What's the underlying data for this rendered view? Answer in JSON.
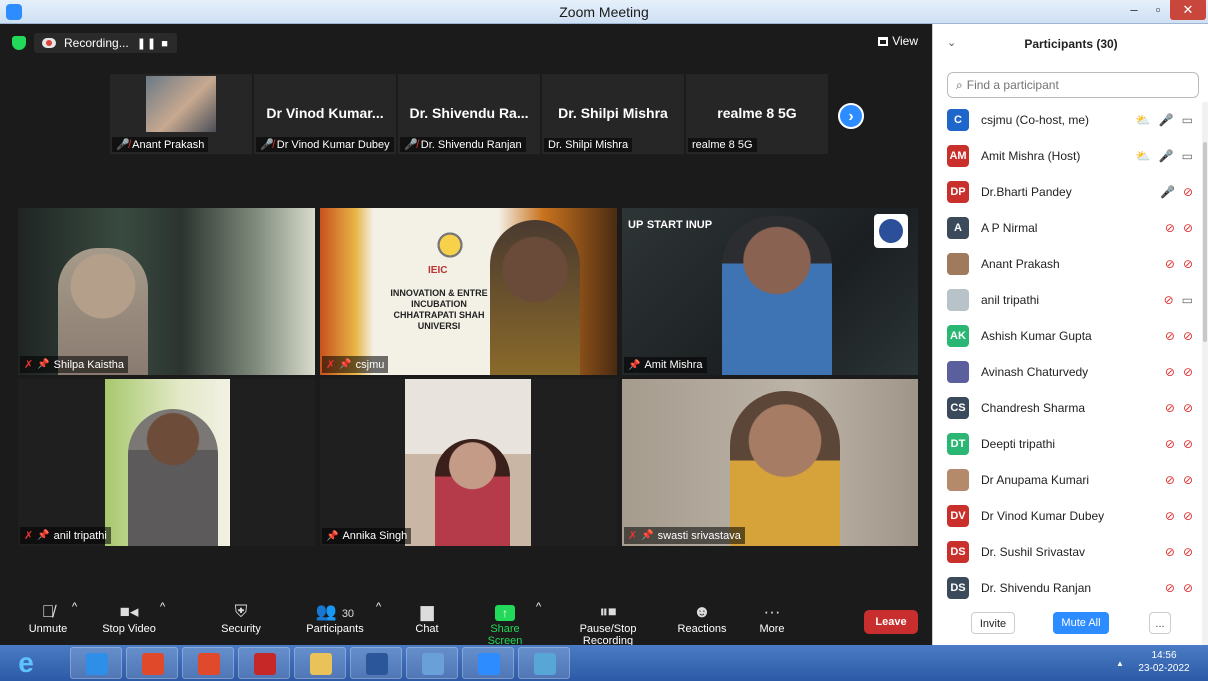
{
  "window": {
    "title": "Zoom Meeting",
    "min": "–",
    "max": "▫",
    "close": "✕"
  },
  "meeting": {
    "recording_label": "Recording...",
    "recording_controls": "❚❚ ■",
    "view_label": "View",
    "filmstrip": [
      {
        "big": "",
        "small": "Anant Prakash",
        "has_video": true
      },
      {
        "big": "Dr Vinod Kumar...",
        "small": "Dr Vinod Kumar Dubey",
        "muted": true
      },
      {
        "big": "Dr. Shivendu Ra...",
        "small": "Dr. Shivendu Ranjan",
        "muted": true
      },
      {
        "big": "Dr. Shilpi Mishra",
        "small": "Dr. Shilpi Mishra",
        "muted": false
      },
      {
        "big": "realme 8 5G",
        "small": "realme 8 5G",
        "muted": false
      }
    ],
    "next_arrow": "›",
    "tiles": [
      {
        "name": "Shilpa Kaistha",
        "muted": true
      },
      {
        "name": "csjmu",
        "muted": true
      },
      {
        "name": "Amit Mishra",
        "muted": false
      },
      {
        "name": "anil tripathi",
        "muted": true
      },
      {
        "name": "Annika Singh",
        "muted": false
      },
      {
        "name": "swasti srivastava",
        "muted": true
      }
    ],
    "slide": {
      "logo_text": "IEIC",
      "banner": "INNOVATION & ENTRE\nINCUBATION\nCHHATRAPATI SHAH\nUNIVERSI"
    },
    "startup_logo": {
      "up": "UP",
      "text": "START INUP"
    }
  },
  "toolbar": {
    "unmute": "Unmute",
    "stop_video": "Stop Video",
    "security": "Security",
    "participants": "Participants",
    "participants_count": "30",
    "chat": "Chat",
    "share_screen": "Share Screen",
    "pause_stop_recording": "Pause/Stop Recording",
    "reactions": "Reactions",
    "more": "More",
    "leave": "Leave"
  },
  "panel": {
    "title": "Participants (30)",
    "search_placeholder": "Find a participant",
    "participants": [
      {
        "initials": "C",
        "name": "csjmu (Co-host, me)",
        "color": "#1e66c9",
        "i1": "⛅",
        "i2": "🎤",
        "i3": "▭"
      },
      {
        "initials": "AM",
        "name": "Amit Mishra (Host)",
        "color": "#c9302c",
        "i1": "⛅",
        "i2": "🎤",
        "i3": "▭"
      },
      {
        "initials": "DP",
        "name": "Dr.Bharti Pandey",
        "color": "#c9302c",
        "i2": "🎤",
        "i3": "⊘"
      },
      {
        "initials": "A",
        "name": "A P Nirmal",
        "color": "#3b4a5a",
        "i2": "⊘",
        "i3": "⊘"
      },
      {
        "initials": "",
        "name": "Anant Prakash",
        "color": "#a07a5c",
        "i2": "⊘",
        "i3": "⊘"
      },
      {
        "initials": "",
        "name": "anil tripathi",
        "color": "#b8c2c9",
        "i2": "⊘",
        "i3": "▭"
      },
      {
        "initials": "AK",
        "name": "Ashish Kumar Gupta",
        "color": "#2bb673",
        "i2": "⊘",
        "i3": "⊘"
      },
      {
        "initials": "",
        "name": "Avinash Chaturvedy",
        "color": "#5b5f9e",
        "i2": "⊘",
        "i3": "⊘"
      },
      {
        "initials": "CS",
        "name": "Chandresh Sharma",
        "color": "#3b4a5a",
        "i2": "⊘",
        "i3": "⊘"
      },
      {
        "initials": "DT",
        "name": "Deepti tripathi",
        "color": "#2bb673",
        "i2": "⊘",
        "i3": "⊘"
      },
      {
        "initials": "",
        "name": "Dr Anupama Kumari",
        "color": "#b48a6a",
        "i2": "⊘",
        "i3": "⊘"
      },
      {
        "initials": "DV",
        "name": "Dr Vinod Kumar Dubey",
        "color": "#c9302c",
        "i2": "⊘",
        "i3": "⊘"
      },
      {
        "initials": "DS",
        "name": "Dr.  Sushil Srivastav",
        "color": "#c9302c",
        "i2": "⊘",
        "i3": "⊘"
      },
      {
        "initials": "DS",
        "name": "Dr. Shivendu Ranjan",
        "color": "#3b4a5a",
        "i2": "⊘",
        "i3": "⊘"
      }
    ],
    "invite": "Invite",
    "mute_all": "Mute All",
    "more": "..."
  },
  "taskbar": {
    "time": "14:56",
    "date": "23-02-2022",
    "apps": [
      "ie-icon",
      "chrome-icon",
      "ppt-icon",
      "pdf-icon",
      "folder-icon",
      "word-icon",
      "paint-icon",
      "zoom-icon",
      "photos-icon"
    ]
  }
}
